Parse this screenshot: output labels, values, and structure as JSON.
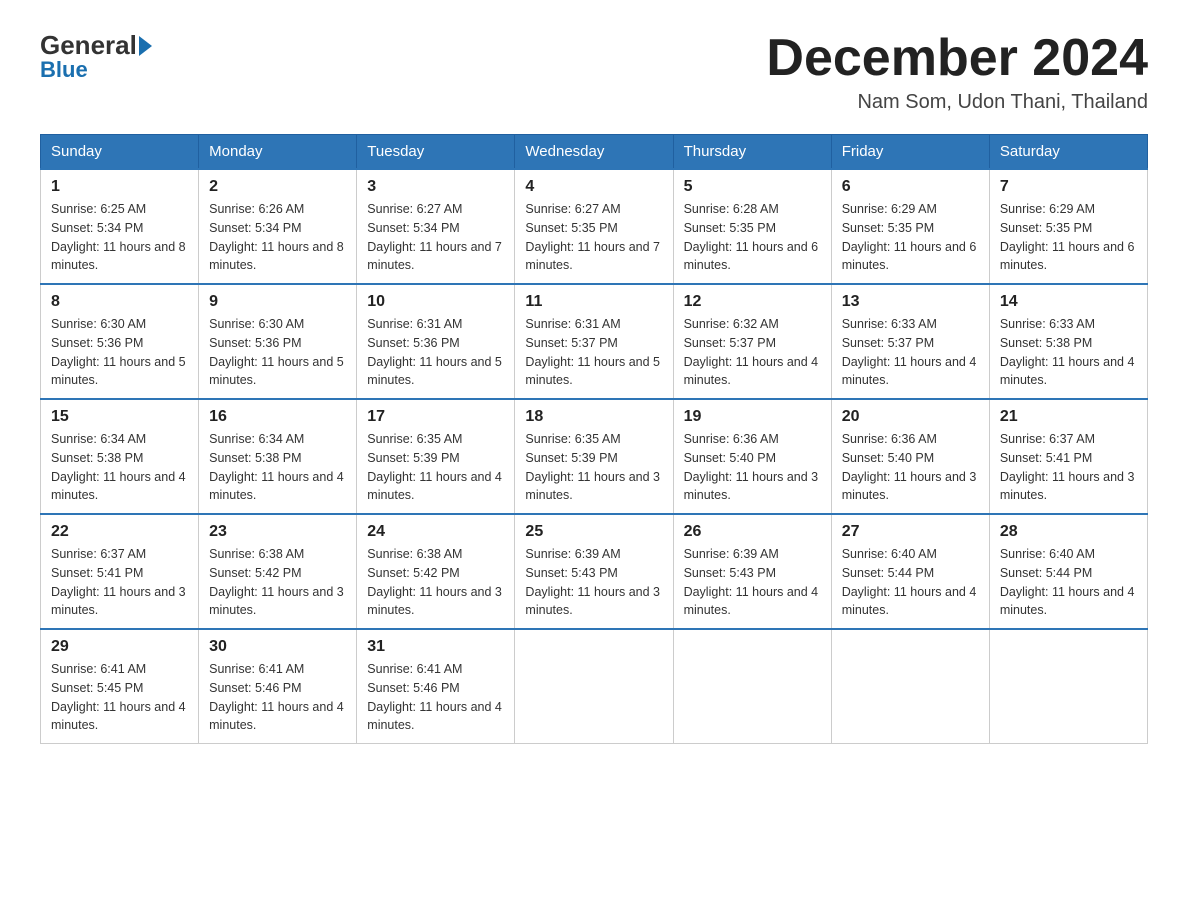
{
  "header": {
    "logo_general": "General",
    "logo_blue": "Blue",
    "main_title": "December 2024",
    "subtitle": "Nam Som, Udon Thani, Thailand"
  },
  "days_of_week": [
    "Sunday",
    "Monday",
    "Tuesday",
    "Wednesday",
    "Thursday",
    "Friday",
    "Saturday"
  ],
  "weeks": [
    [
      {
        "day": "1",
        "sunrise": "6:25 AM",
        "sunset": "5:34 PM",
        "daylight": "11 hours and 8 minutes."
      },
      {
        "day": "2",
        "sunrise": "6:26 AM",
        "sunset": "5:34 PM",
        "daylight": "11 hours and 8 minutes."
      },
      {
        "day": "3",
        "sunrise": "6:27 AM",
        "sunset": "5:34 PM",
        "daylight": "11 hours and 7 minutes."
      },
      {
        "day": "4",
        "sunrise": "6:27 AM",
        "sunset": "5:35 PM",
        "daylight": "11 hours and 7 minutes."
      },
      {
        "day": "5",
        "sunrise": "6:28 AM",
        "sunset": "5:35 PM",
        "daylight": "11 hours and 6 minutes."
      },
      {
        "day": "6",
        "sunrise": "6:29 AM",
        "sunset": "5:35 PM",
        "daylight": "11 hours and 6 minutes."
      },
      {
        "day": "7",
        "sunrise": "6:29 AM",
        "sunset": "5:35 PM",
        "daylight": "11 hours and 6 minutes."
      }
    ],
    [
      {
        "day": "8",
        "sunrise": "6:30 AM",
        "sunset": "5:36 PM",
        "daylight": "11 hours and 5 minutes."
      },
      {
        "day": "9",
        "sunrise": "6:30 AM",
        "sunset": "5:36 PM",
        "daylight": "11 hours and 5 minutes."
      },
      {
        "day": "10",
        "sunrise": "6:31 AM",
        "sunset": "5:36 PM",
        "daylight": "11 hours and 5 minutes."
      },
      {
        "day": "11",
        "sunrise": "6:31 AM",
        "sunset": "5:37 PM",
        "daylight": "11 hours and 5 minutes."
      },
      {
        "day": "12",
        "sunrise": "6:32 AM",
        "sunset": "5:37 PM",
        "daylight": "11 hours and 4 minutes."
      },
      {
        "day": "13",
        "sunrise": "6:33 AM",
        "sunset": "5:37 PM",
        "daylight": "11 hours and 4 minutes."
      },
      {
        "day": "14",
        "sunrise": "6:33 AM",
        "sunset": "5:38 PM",
        "daylight": "11 hours and 4 minutes."
      }
    ],
    [
      {
        "day": "15",
        "sunrise": "6:34 AM",
        "sunset": "5:38 PM",
        "daylight": "11 hours and 4 minutes."
      },
      {
        "day": "16",
        "sunrise": "6:34 AM",
        "sunset": "5:38 PM",
        "daylight": "11 hours and 4 minutes."
      },
      {
        "day": "17",
        "sunrise": "6:35 AM",
        "sunset": "5:39 PM",
        "daylight": "11 hours and 4 minutes."
      },
      {
        "day": "18",
        "sunrise": "6:35 AM",
        "sunset": "5:39 PM",
        "daylight": "11 hours and 3 minutes."
      },
      {
        "day": "19",
        "sunrise": "6:36 AM",
        "sunset": "5:40 PM",
        "daylight": "11 hours and 3 minutes."
      },
      {
        "day": "20",
        "sunrise": "6:36 AM",
        "sunset": "5:40 PM",
        "daylight": "11 hours and 3 minutes."
      },
      {
        "day": "21",
        "sunrise": "6:37 AM",
        "sunset": "5:41 PM",
        "daylight": "11 hours and 3 minutes."
      }
    ],
    [
      {
        "day": "22",
        "sunrise": "6:37 AM",
        "sunset": "5:41 PM",
        "daylight": "11 hours and 3 minutes."
      },
      {
        "day": "23",
        "sunrise": "6:38 AM",
        "sunset": "5:42 PM",
        "daylight": "11 hours and 3 minutes."
      },
      {
        "day": "24",
        "sunrise": "6:38 AM",
        "sunset": "5:42 PM",
        "daylight": "11 hours and 3 minutes."
      },
      {
        "day": "25",
        "sunrise": "6:39 AM",
        "sunset": "5:43 PM",
        "daylight": "11 hours and 3 minutes."
      },
      {
        "day": "26",
        "sunrise": "6:39 AM",
        "sunset": "5:43 PM",
        "daylight": "11 hours and 4 minutes."
      },
      {
        "day": "27",
        "sunrise": "6:40 AM",
        "sunset": "5:44 PM",
        "daylight": "11 hours and 4 minutes."
      },
      {
        "day": "28",
        "sunrise": "6:40 AM",
        "sunset": "5:44 PM",
        "daylight": "11 hours and 4 minutes."
      }
    ],
    [
      {
        "day": "29",
        "sunrise": "6:41 AM",
        "sunset": "5:45 PM",
        "daylight": "11 hours and 4 minutes."
      },
      {
        "day": "30",
        "sunrise": "6:41 AM",
        "sunset": "5:46 PM",
        "daylight": "11 hours and 4 minutes."
      },
      {
        "day": "31",
        "sunrise": "6:41 AM",
        "sunset": "5:46 PM",
        "daylight": "11 hours and 4 minutes."
      },
      null,
      null,
      null,
      null
    ]
  ]
}
